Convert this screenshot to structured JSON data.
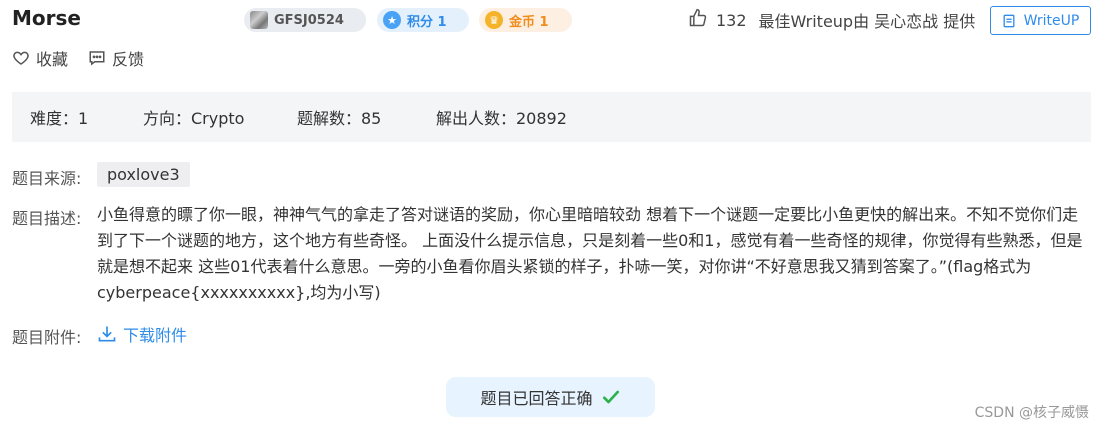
{
  "header": {
    "title": "Morse",
    "badges": {
      "id": "GFSJ0524",
      "score": "积分 1",
      "gold": "金币 1"
    },
    "likes": "132",
    "writeup_credit": "最佳Writeup由 吴心恋战 提供",
    "writeup_button": "WriteUP"
  },
  "actions": {
    "favorite": "收藏",
    "feedback": "反馈"
  },
  "stats": {
    "difficulty": "难度：1",
    "direction": "方向：Crypto",
    "solves": "题解数：85",
    "solvers": "解出人数：20892"
  },
  "details": {
    "source_label": "题目来源:",
    "source_value": "poxlove3",
    "desc_label": "题目描述:",
    "desc_value": "小鱼得意的瞟了你一眼，神神气气的拿走了答对谜语的奖励，你心里暗暗较劲 想着下一个谜题一定要比小鱼更快的解出来。不知不觉你们走到了下一个谜题的地方，这个地方有些奇怪。 上面没什么提示信息，只是刻着一些0和1，感觉有着一些奇怪的规律，你觉得有些熟悉，但是就是想不起来 这些01代表着什么意思。一旁的小鱼看你眉头紧锁的样子，扑哧一笑，对你讲“不好意思我又猜到答案了。”(flag格式为cyberpeace{xxxxxxxxxx},均为小写)",
    "attach_label": "题目附件:",
    "attach_value": "下载附件"
  },
  "status": {
    "answered": "题目已回答正确"
  },
  "watermark": "CSDN @核子威慑",
  "colors": {
    "accent": "#2f8ce9",
    "success": "#2bb24c",
    "gold": "#f08c1c"
  }
}
